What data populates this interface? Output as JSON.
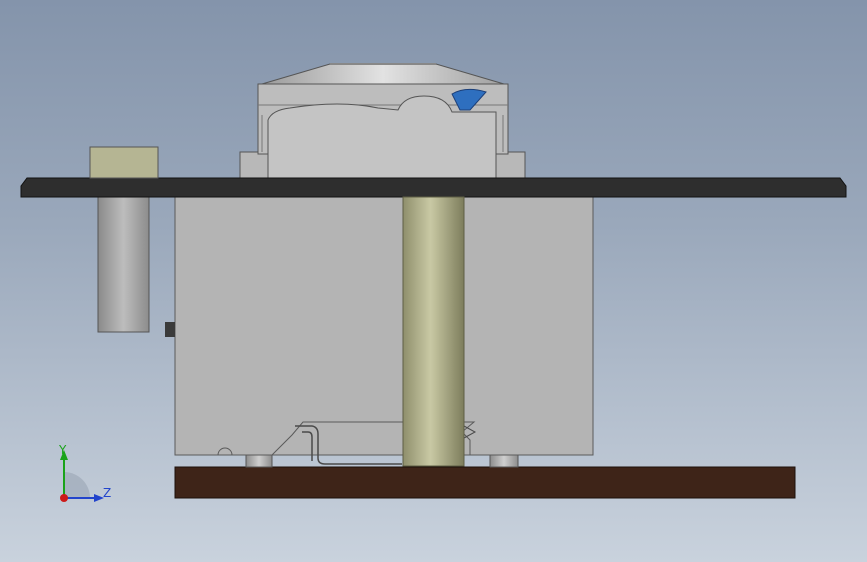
{
  "viewport": {
    "background_top": "#8494ab",
    "background_bottom": "#c9d2dd"
  },
  "model": {
    "board_color": "#2e2e2e",
    "housing_color": "#b4b4b4",
    "cap_color": "#c9c9c9",
    "pin_color": "#b7b78f",
    "block_color": "#b5b593",
    "base_color": "#3e2418",
    "indicator_color": "#2e6fbf"
  },
  "triad": {
    "y_label": "Y",
    "z_label": "Z",
    "y_color": "#1aa31a",
    "z_color": "#2244cc",
    "x_color": "#cc1a1a"
  }
}
